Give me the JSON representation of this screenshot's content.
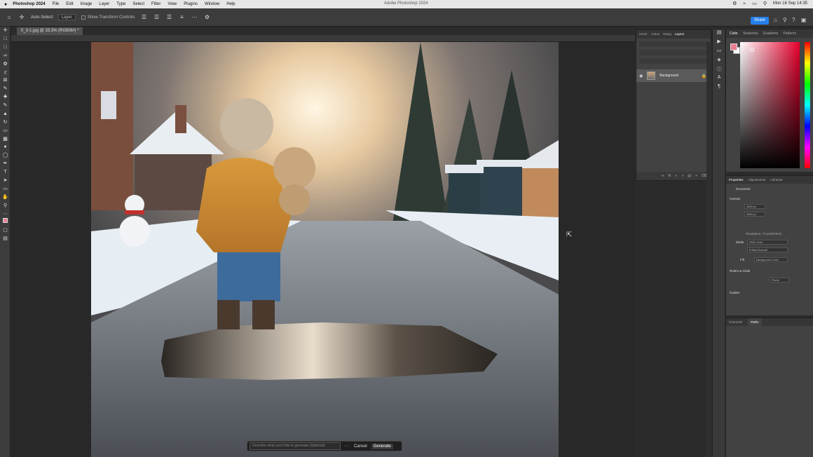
{
  "macbar": {
    "apple": "",
    "menus": [
      "Photoshop 2024",
      "File",
      "Edit",
      "Image",
      "Layer",
      "Type",
      "Select",
      "Filter",
      "View",
      "Plugins",
      "Window",
      "Help"
    ],
    "window_title": "Adobe Photoshop 2024",
    "clock": "Mon 16 Sep 14:35"
  },
  "options": {
    "auto_select_label": "Auto-Select:",
    "auto_select_value": "Layer",
    "show_transform_label": "Show Transform Controls",
    "share_label": "Share"
  },
  "document": {
    "tab_title": "0_3-1.jpg @ 33.3% (RGB/8#) *"
  },
  "layers_panel": {
    "tabs": [
      "Histor",
      "Action",
      "Navig",
      "Layers"
    ],
    "active_tab": "Layers",
    "layer_name": "Background"
  },
  "color_panel": {
    "tabs": [
      "Color",
      "Swatches",
      "Gradients",
      "Patterns"
    ],
    "active_tab": "Color",
    "foreground": "#ea7c92",
    "background": "#ffffff"
  },
  "properties_panel": {
    "tabs": [
      "Properties",
      "Adjustments",
      "Libraries"
    ],
    "active_tab": "Properties",
    "doc_label": "Document",
    "canvas_section": "Canvas",
    "width_value": "3840 px",
    "height_value": "3840 px",
    "resolution_text": "Resolution: 72 pixels/inch",
    "mode_label": "Mode",
    "mode_value": "RGB Color",
    "depth_value": "8 Bits/Channel",
    "fill_label": "Fill",
    "fill_value": "Background Color",
    "rulers_section": "Rulers & Grids",
    "units_value": "Pixels",
    "guides_section": "Guides"
  },
  "channels_panel": {
    "tabs": [
      "Channels",
      "Paths"
    ],
    "active_tab": "Paths"
  },
  "generative_bar": {
    "placeholder": "Describe what you'd like to generate (Optional)",
    "cancel_label": "Cancel",
    "generate_label": "Generate"
  }
}
